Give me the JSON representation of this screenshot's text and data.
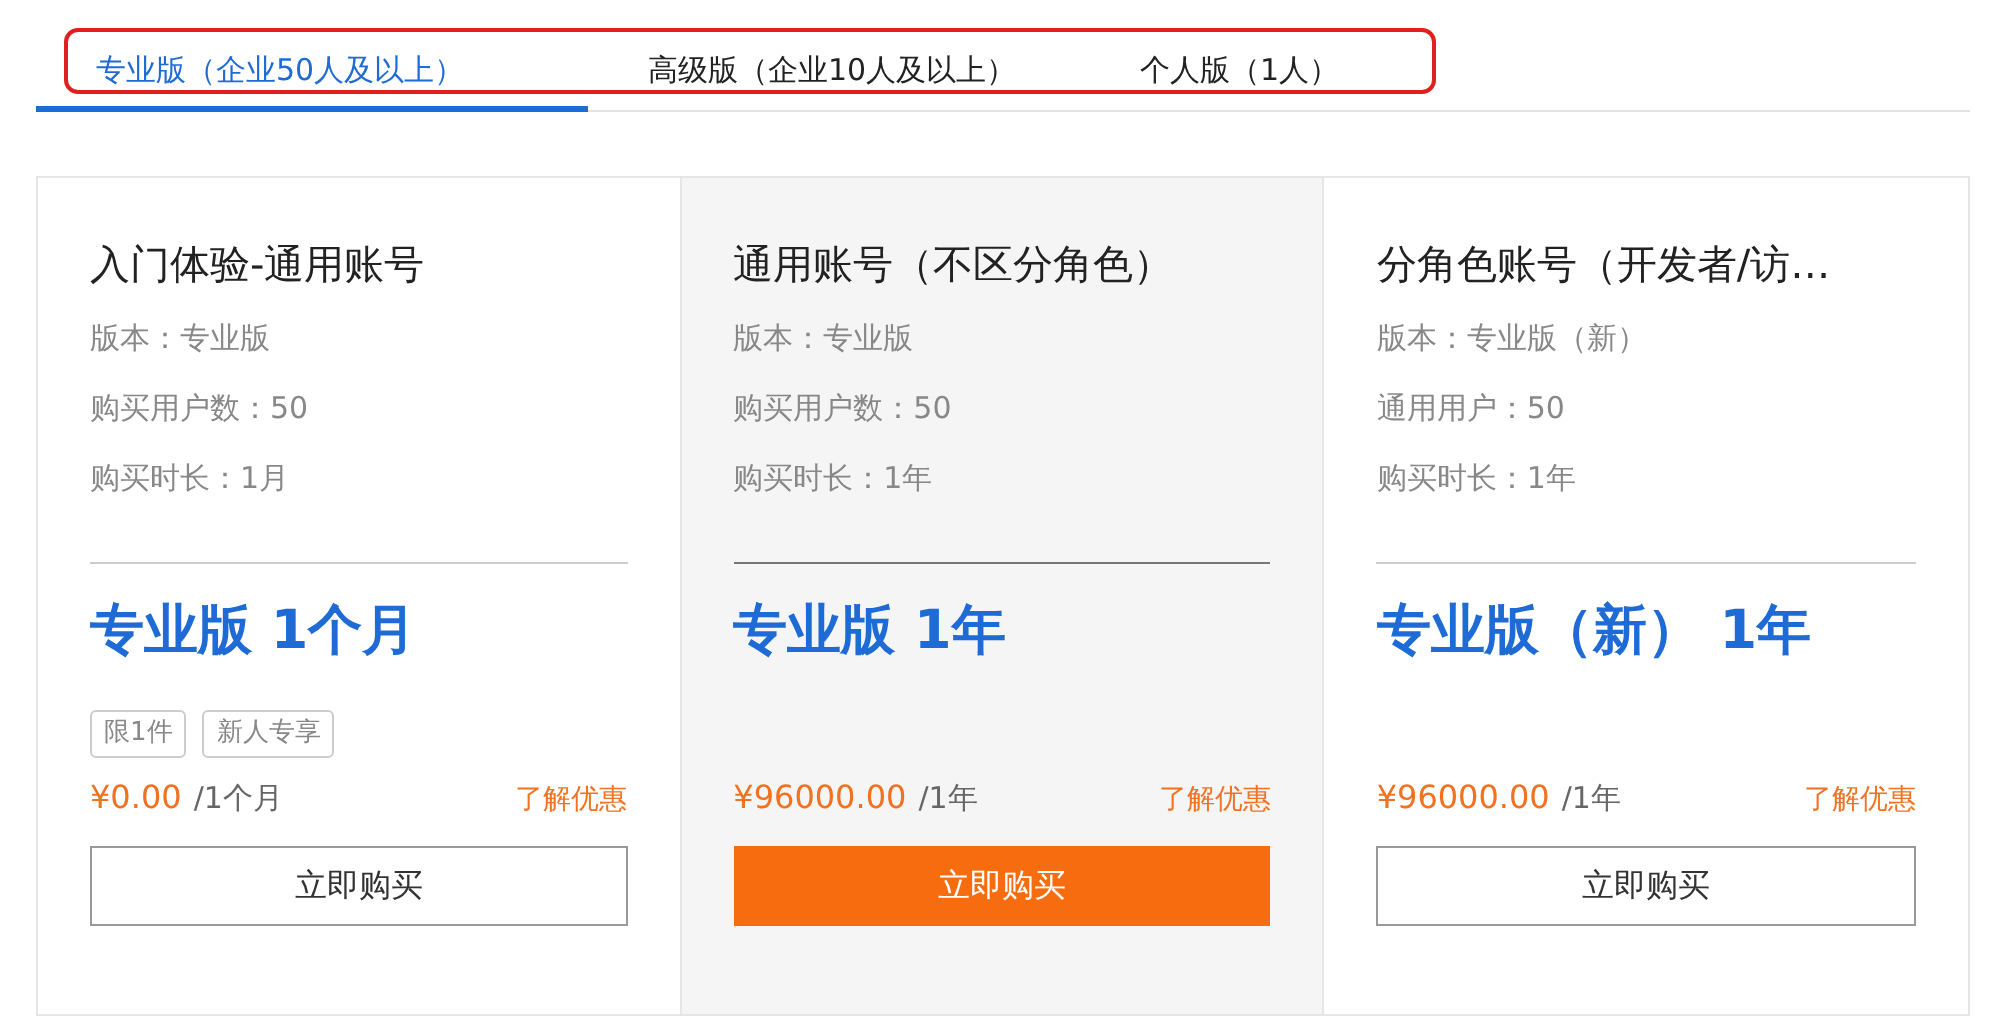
{
  "tabs": [
    {
      "label": "专业版（企业50人及以上）",
      "selected": true
    },
    {
      "label": "高级版（企业10人及以上）",
      "selected": false
    },
    {
      "label": "个人版（1人）",
      "selected": false
    }
  ],
  "tabs_highlighted": true,
  "plans": [
    {
      "title": "入门体验-通用账号",
      "details": [
        "版本：专业版",
        "购买用户数：50",
        "购买时长：1月"
      ],
      "headline": "专业版 1个月",
      "tags": [
        "限1件",
        "新人专享"
      ],
      "price": "¥0.00",
      "period": "/1个月",
      "offer_link": "了解优惠",
      "button": "立即购买",
      "selected": false
    },
    {
      "title": "通用账号（不区分角色）",
      "details": [
        "版本：专业版",
        "购买用户数：50",
        "购买时长：1年"
      ],
      "headline": "专业版 1年",
      "price": "¥96000.00",
      "period": "/1年",
      "offer_link": "了解优惠",
      "button": "立即购买",
      "selected": true
    },
    {
      "title": "分角色账号（开发者/访…",
      "details": [
        "版本：专业版（新）",
        "通用用户：50",
        "购买时长：1年"
      ],
      "headline": "专业版（新） 1年",
      "price": "¥96000.00",
      "period": "/1年",
      "offer_link": "了解优惠",
      "button": "立即购买",
      "selected": false
    }
  ]
}
